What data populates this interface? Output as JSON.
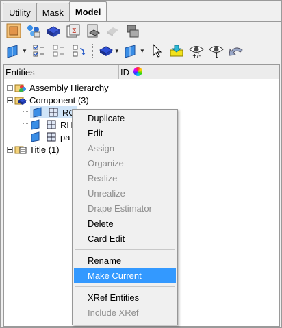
{
  "tabs": [
    {
      "label": "Utility"
    },
    {
      "label": "Mask"
    },
    {
      "label": "Model"
    }
  ],
  "toolbar1": {
    "icons": [
      "component-icon",
      "assembly-icon",
      "material-icon",
      "property-icon",
      "load-collector-icon",
      "disabled-icon",
      "connector-icon"
    ]
  },
  "toolbar2": {
    "icons": [
      "entity-filter-icon",
      "checkbox-list-icon",
      "tree-icon",
      "sync-icon",
      "display-mode-icon",
      "surface-mode-icon",
      "select-arrow-icon",
      "current-folder-icon",
      "show-hide-icon",
      "isolate-icon",
      "undo-icon"
    ],
    "eye_labels": [
      "+/-",
      "1"
    ]
  },
  "header": {
    "entities": "Entities",
    "id": "ID"
  },
  "tree": {
    "assembly": "Assembly Hierarchy",
    "component": "Component (3)",
    "child1": "RC",
    "child2": "RH",
    "child3": "pa",
    "title": "Title (1)"
  },
  "menu": {
    "duplicate": "Duplicate",
    "edit": "Edit",
    "assign": "Assign",
    "organize": "Organize",
    "realize": "Realize",
    "unrealize": "Unrealize",
    "drape": "Drape Estimator",
    "delete": "Delete",
    "card_edit": "Card Edit",
    "rename": "Rename",
    "make_current": "Make Current",
    "xref": "XRef Entities",
    "include_xref": "Include XRef"
  }
}
